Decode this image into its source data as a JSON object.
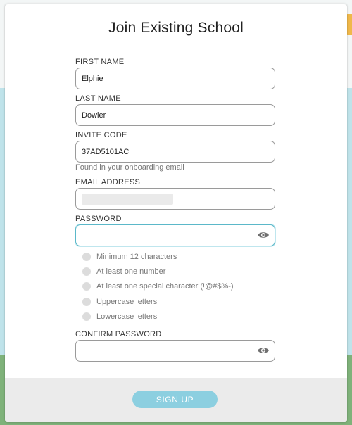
{
  "title": "Join Existing School",
  "fields": {
    "first_name": {
      "label": "FIRST NAME",
      "value": "Elphie"
    },
    "last_name": {
      "label": "LAST NAME",
      "value": "Dowler"
    },
    "invite_code": {
      "label": "INVITE CODE",
      "value": "37AD5101AC",
      "hint": "Found in your onboarding email"
    },
    "email": {
      "label": "EMAIL ADDRESS",
      "value": ""
    },
    "password": {
      "label": "PASSWORD",
      "value": ""
    },
    "confirm_password": {
      "label": "CONFIRM PASSWORD",
      "value": ""
    }
  },
  "password_requirements": [
    "Minimum 12 characters",
    "At least one number",
    "At least one special character (!@#$%-)",
    "Uppercase letters",
    "Lowercase letters"
  ],
  "signup_label": "SIGN UP",
  "colors": {
    "accent": "#5bb8c9",
    "signup_button": "#8ccfe0",
    "footer": "#ebebeb"
  },
  "icons": {
    "password_toggle": "eye-icon",
    "confirm_password_toggle": "eye-icon"
  }
}
